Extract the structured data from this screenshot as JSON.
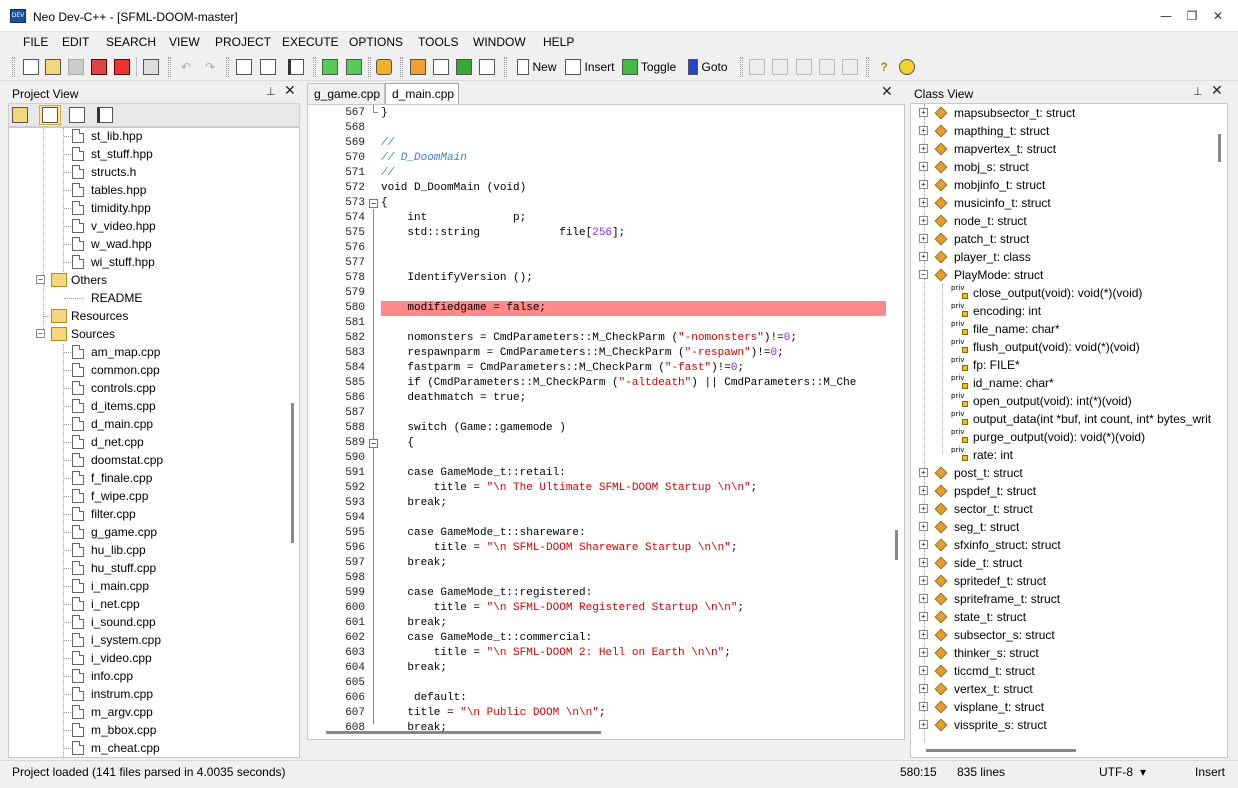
{
  "window": {
    "title": "Neo Dev-C++ - [SFML-DOOM-master]",
    "app_icon": "DEV",
    "minimize": "—",
    "maximize": "❐",
    "close": "✕"
  },
  "menu": [
    "FILE",
    "EDIT",
    "SEARCH",
    "VIEW",
    "PROJECT",
    "EXECUTE",
    "OPTIONS",
    "TOOLS",
    "WINDOW",
    "HELP"
  ],
  "toolbar": {
    "new_label": "New",
    "insert_label": "Insert",
    "toggle_label": "Toggle",
    "goto_label": "Goto"
  },
  "project_view": {
    "title": "Project View",
    "pin": "⊥",
    "close": "✕",
    "items": [
      {
        "label": "st_lib.hpp",
        "kind": "file"
      },
      {
        "label": "st_stuff.hpp",
        "kind": "file"
      },
      {
        "label": "structs.h",
        "kind": "file"
      },
      {
        "label": "tables.hpp",
        "kind": "file"
      },
      {
        "label": "timidity.hpp",
        "kind": "file"
      },
      {
        "label": "v_video.hpp",
        "kind": "file"
      },
      {
        "label": "w_wad.hpp",
        "kind": "file"
      },
      {
        "label": "wi_stuff.hpp",
        "kind": "file"
      },
      {
        "label": "Others",
        "kind": "folder"
      },
      {
        "label": "README",
        "kind": "child-noicon"
      },
      {
        "label": "Resources",
        "kind": "folder-leaf"
      },
      {
        "label": "Sources",
        "kind": "folder"
      },
      {
        "label": "am_map.cpp",
        "kind": "file"
      },
      {
        "label": "common.cpp",
        "kind": "file"
      },
      {
        "label": "controls.cpp",
        "kind": "file"
      },
      {
        "label": "d_items.cpp",
        "kind": "file"
      },
      {
        "label": "d_main.cpp",
        "kind": "file"
      },
      {
        "label": "d_net.cpp",
        "kind": "file"
      },
      {
        "label": "doomstat.cpp",
        "kind": "file"
      },
      {
        "label": "f_finale.cpp",
        "kind": "file"
      },
      {
        "label": "f_wipe.cpp",
        "kind": "file"
      },
      {
        "label": "filter.cpp",
        "kind": "file"
      },
      {
        "label": "g_game.cpp",
        "kind": "file"
      },
      {
        "label": "hu_lib.cpp",
        "kind": "file"
      },
      {
        "label": "hu_stuff.cpp",
        "kind": "file"
      },
      {
        "label": "i_main.cpp",
        "kind": "file"
      },
      {
        "label": "i_net.cpp",
        "kind": "file"
      },
      {
        "label": "i_sound.cpp",
        "kind": "file"
      },
      {
        "label": "i_system.cpp",
        "kind": "file"
      },
      {
        "label": "i_video.cpp",
        "kind": "file"
      },
      {
        "label": "info.cpp",
        "kind": "file"
      },
      {
        "label": "instrum.cpp",
        "kind": "file"
      },
      {
        "label": "m_argv.cpp",
        "kind": "file"
      },
      {
        "label": "m_bbox.cpp",
        "kind": "file"
      },
      {
        "label": "m_cheat.cpp",
        "kind": "file"
      }
    ]
  },
  "editor": {
    "tabs": [
      "g_game.cpp",
      "d_main.cpp"
    ],
    "active_tab": "d_main.cpp",
    "close": "✕",
    "lines": [
      {
        "n": "567",
        "t": "}"
      },
      {
        "n": "568",
        "t": ""
      },
      {
        "n": "569",
        "t": "//"
      },
      {
        "n": "570",
        "t": "// D_DoomMain"
      },
      {
        "n": "571",
        "t": "//"
      },
      {
        "n": "572",
        "t": "void D_DoomMain (void)"
      },
      {
        "n": "573",
        "t": "{"
      },
      {
        "n": "574",
        "t": "    int             p;"
      },
      {
        "n": "575",
        "t": "    std::string            file[256];"
      },
      {
        "n": "576",
        "t": ""
      },
      {
        "n": "577",
        "t": ""
      },
      {
        "n": "578",
        "t": "    IdentifyVersion ();"
      },
      {
        "n": "579",
        "t": ""
      },
      {
        "n": "580",
        "t": "    modifiedgame = false;"
      },
      {
        "n": "581",
        "t": ""
      },
      {
        "n": "582",
        "t": "    nomonsters = CmdParameters::M_CheckParm (\"-nomonsters\")!=0;"
      },
      {
        "n": "583",
        "t": "    respawnparm = CmdParameters::M_CheckParm (\"-respawn\")!=0;"
      },
      {
        "n": "584",
        "t": "    fastparm = CmdParameters::M_CheckParm (\"-fast\")!=0;"
      },
      {
        "n": "585",
        "t": "    if (CmdParameters::M_CheckParm (\"-altdeath\") || CmdParameters::M_Che"
      },
      {
        "n": "586",
        "t": "    deathmatch = true;"
      },
      {
        "n": "587",
        "t": ""
      },
      {
        "n": "588",
        "t": "    switch (Game::gamemode )"
      },
      {
        "n": "589",
        "t": "    {"
      },
      {
        "n": "590",
        "t": ""
      },
      {
        "n": "591",
        "t": "    case GameMode_t::retail:"
      },
      {
        "n": "592",
        "t": "        title = \"\\n The Ultimate SFML-DOOM Startup \\n\\n\";"
      },
      {
        "n": "593",
        "t": "    break;"
      },
      {
        "n": "594",
        "t": ""
      },
      {
        "n": "595",
        "t": "    case GameMode_t::shareware:"
      },
      {
        "n": "596",
        "t": "        title = \"\\n SFML-DOOM Shareware Startup \\n\\n\";"
      },
      {
        "n": "597",
        "t": "    break;"
      },
      {
        "n": "598",
        "t": ""
      },
      {
        "n": "599",
        "t": "    case GameMode_t::registered:"
      },
      {
        "n": "600",
        "t": "        title = \"\\n SFML-DOOM Registered Startup \\n\\n\";"
      },
      {
        "n": "601",
        "t": "    break;"
      },
      {
        "n": "602",
        "t": "    case GameMode_t::commercial:"
      },
      {
        "n": "603",
        "t": "        title = \"\\n SFML-DOOM 2: Hell on Earth \\n\\n\";"
      },
      {
        "n": "604",
        "t": "    break;"
      },
      {
        "n": "605",
        "t": ""
      },
      {
        "n": "606",
        "t": "     default:"
      },
      {
        "n": "607",
        "t": "    title = \"\\n Public DOOM \\n\\n\";"
      },
      {
        "n": "608",
        "t": "    break;"
      }
    ],
    "highlight_line": "580"
  },
  "class_view": {
    "title": "Class View",
    "pin": "⊥",
    "close": "✕",
    "private_badge": "priv",
    "items": [
      {
        "label": "mapsubsector_t: struct",
        "kind": "class"
      },
      {
        "label": "mapthing_t: struct",
        "kind": "class"
      },
      {
        "label": "mapvertex_t: struct",
        "kind": "class"
      },
      {
        "label": "mobj_s: struct",
        "kind": "class"
      },
      {
        "label": "mobjinfo_t: struct",
        "kind": "class"
      },
      {
        "label": "musicinfo_t: struct",
        "kind": "class"
      },
      {
        "label": "node_t: struct",
        "kind": "class"
      },
      {
        "label": "patch_t: struct",
        "kind": "class"
      },
      {
        "label": "player_t: class",
        "kind": "class"
      },
      {
        "label": "PlayMode: struct",
        "kind": "class-open"
      },
      {
        "label": "close_output(void): void(*)(void)",
        "kind": "member"
      },
      {
        "label": "encoding: int",
        "kind": "member"
      },
      {
        "label": "file_name: char*",
        "kind": "member"
      },
      {
        "label": "flush_output(void): void(*)(void)",
        "kind": "member"
      },
      {
        "label": "fp: FILE*",
        "kind": "member"
      },
      {
        "label": "id_name: char*",
        "kind": "member"
      },
      {
        "label": "open_output(void): int(*)(void)",
        "kind": "member"
      },
      {
        "label": "output_data(int *buf, int count, int* bytes_writ",
        "kind": "member"
      },
      {
        "label": "purge_output(void): void(*)(void)",
        "kind": "member"
      },
      {
        "label": "rate: int",
        "kind": "member"
      },
      {
        "label": "post_t: struct",
        "kind": "class"
      },
      {
        "label": "pspdef_t: struct",
        "kind": "class"
      },
      {
        "label": "sector_t: struct",
        "kind": "class"
      },
      {
        "label": "seg_t: struct",
        "kind": "class"
      },
      {
        "label": "sfxinfo_struct: struct",
        "kind": "class"
      },
      {
        "label": "side_t: struct",
        "kind": "class"
      },
      {
        "label": "spritedef_t: struct",
        "kind": "class"
      },
      {
        "label": "spriteframe_t: struct",
        "kind": "class"
      },
      {
        "label": "state_t: struct",
        "kind": "class"
      },
      {
        "label": "subsector_s: struct",
        "kind": "class"
      },
      {
        "label": "thinker_s: struct",
        "kind": "class"
      },
      {
        "label": "ticcmd_t: struct",
        "kind": "class"
      },
      {
        "label": "vertex_t: struct",
        "kind": "class"
      },
      {
        "label": "visplane_t: struct",
        "kind": "class"
      },
      {
        "label": "vissprite_s: struct",
        "kind": "class"
      }
    ]
  },
  "status": {
    "message": "Project loaded (141 files parsed in 4.0035 seconds)",
    "position": "580:15",
    "lines": "835 lines",
    "encoding": "UTF-8",
    "encoding_arrow": "▾",
    "mode": "Insert"
  },
  "colors": {
    "highlight": "#ff8888",
    "comment": "#3a7fd6",
    "string": "#d40000",
    "number": "#8a2be2"
  }
}
